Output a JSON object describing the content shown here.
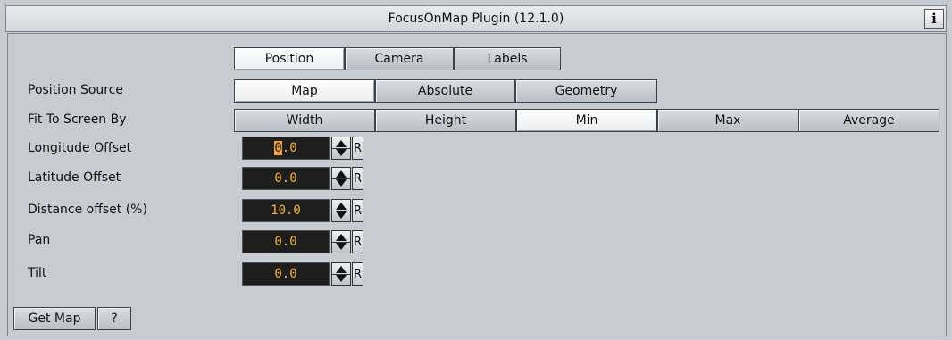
{
  "window": {
    "title": "FocusOnMap Plugin (12.1.0)",
    "info_label": "i"
  },
  "tabs": [
    {
      "label": "Position",
      "active": true
    },
    {
      "label": "Camera",
      "active": false
    },
    {
      "label": "Labels",
      "active": false
    }
  ],
  "position_source": {
    "label": "Position Source",
    "options": [
      "Map",
      "Absolute",
      "Geometry"
    ],
    "selected": "Map"
  },
  "fit_to_screen": {
    "label": "Fit To Screen By",
    "options": [
      "Width",
      "Height",
      "Min",
      "Max",
      "Average"
    ],
    "selected": "Min"
  },
  "fields": {
    "longitude": {
      "label": "Longitude Offset",
      "value_selected": "0",
      "value_rest": ".0",
      "reset": "R"
    },
    "latitude": {
      "label": "Latitude Offset",
      "value": "0.0",
      "reset": "R"
    },
    "distance": {
      "label": "Distance offset (%)",
      "value": "10.0",
      "reset": "R"
    },
    "pan": {
      "label": "Pan",
      "value": "0.0",
      "reset": "R"
    },
    "tilt": {
      "label": "Tilt",
      "value": "0.0",
      "reset": "R"
    }
  },
  "footer": {
    "get_map_label": "Get Map",
    "help_label": "?"
  },
  "colors": {
    "value_text": "#f2b33d",
    "value_bg": "#1e1e1e",
    "selection": "#f2a13a",
    "panel_bg": "#c7ccd2"
  }
}
